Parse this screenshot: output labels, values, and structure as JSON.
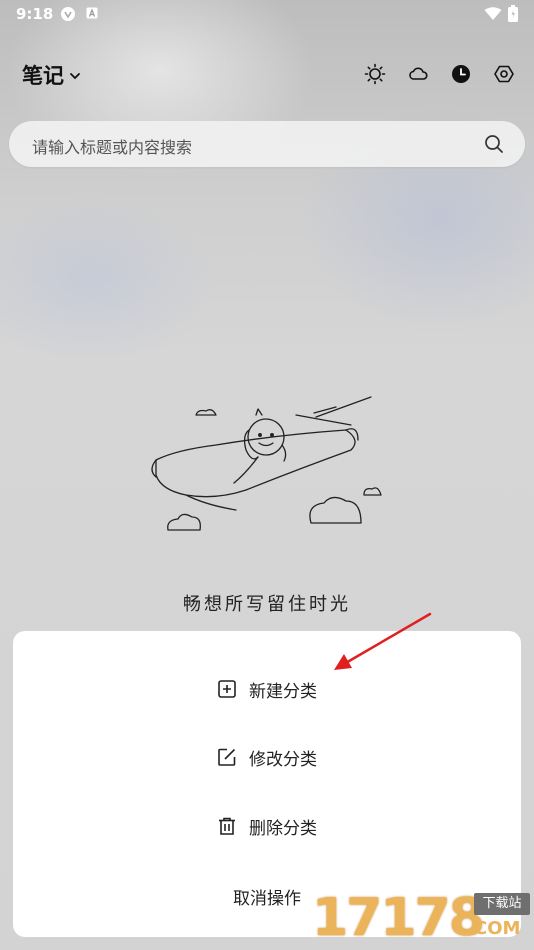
{
  "status_bar": {
    "time": "9:18"
  },
  "header": {
    "title": "笔记"
  },
  "search": {
    "placeholder": "请输入标题或内容搜索"
  },
  "empty_state": {
    "slogan": "畅想所写留住时光"
  },
  "action_sheet": {
    "items": [
      {
        "label": "新建分类",
        "icon": "plus-square-icon"
      },
      {
        "label": "修改分类",
        "icon": "edit-icon"
      },
      {
        "label": "删除分类",
        "icon": "trash-icon"
      }
    ],
    "cancel_label": "取消操作"
  },
  "watermark": {
    "number": "17178",
    "tag": "下载站",
    "suffix": "COM"
  },
  "colors": {
    "accent_arrow": "#e02020",
    "watermark": "#ebb35a"
  }
}
